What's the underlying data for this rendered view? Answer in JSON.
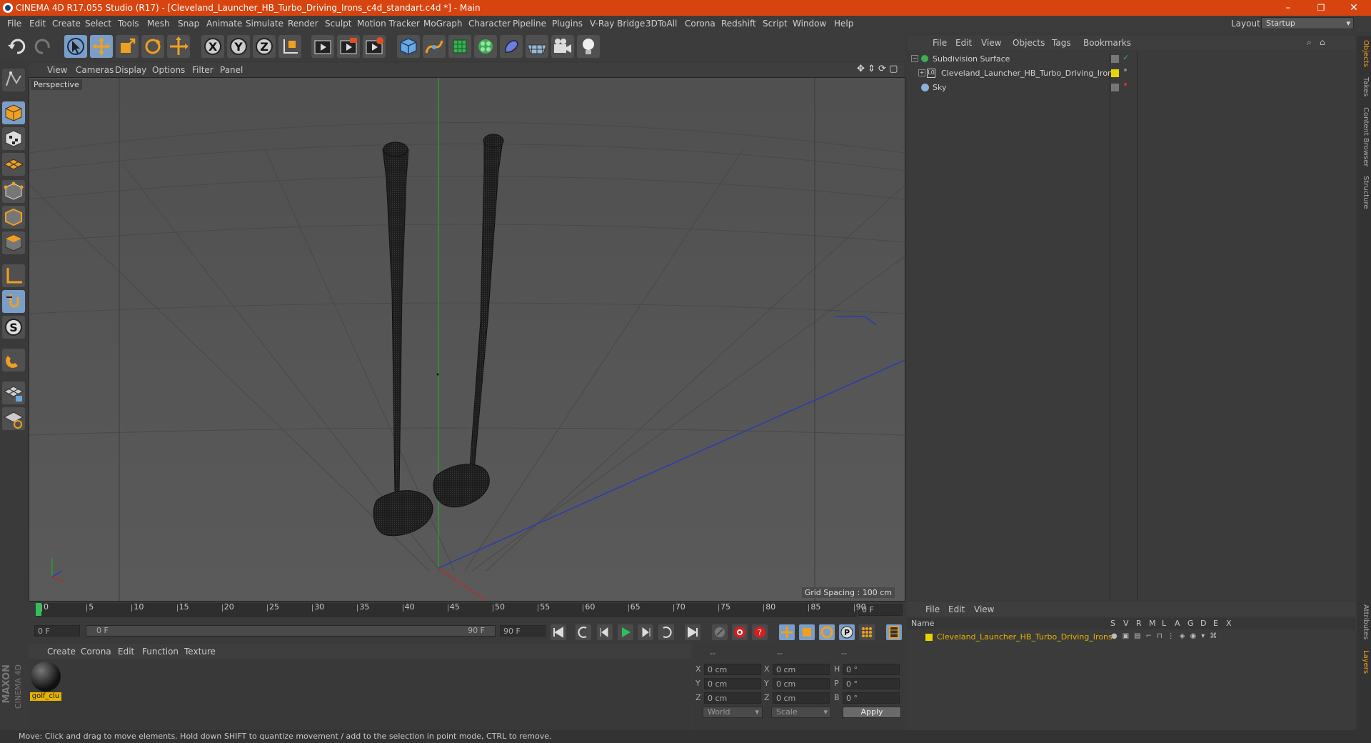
{
  "window": {
    "title": "CINEMA 4D R17.055 Studio (R17) - [Cleveland_Launcher_HB_Turbo_Driving_Irons_c4d_standart.c4d *] - Main",
    "minimize": "–",
    "restore": "❐",
    "close": "✕"
  },
  "menubar": {
    "items": [
      "File",
      "Edit",
      "Create",
      "Select",
      "Tools",
      "Mesh",
      "Snap",
      "Animate",
      "Simulate",
      "Render",
      "Sculpt",
      "Motion Tracker",
      "MoGraph",
      "Character",
      "Pipeline",
      "Plugins",
      "V-Ray Bridge",
      "3DToAll",
      "Corona",
      "Redshift",
      "Script",
      "Window",
      "Help"
    ],
    "layout_label": "Layout:",
    "layout_value": "Startup"
  },
  "viewport": {
    "menu": [
      "View",
      "Cameras",
      "Display",
      "Options",
      "Filter",
      "Panel"
    ],
    "camera": "Perspective",
    "grid_spacing": "Grid Spacing : 100 cm"
  },
  "timeline": {
    "ticks": [
      "0",
      "5",
      "10",
      "15",
      "20",
      "25",
      "30",
      "35",
      "40",
      "45",
      "50",
      "55",
      "60",
      "65",
      "70",
      "75",
      "80",
      "85",
      "90"
    ],
    "current_frame": "0 F",
    "start_field": "0 F",
    "range_start": "0 F",
    "range_end": "90 F",
    "end_field": "90 F"
  },
  "materials": {
    "menu": [
      "Create",
      "Corona",
      "Edit",
      "Function",
      "Texture"
    ],
    "items": [
      {
        "name": "golf_clu"
      }
    ]
  },
  "coords": {
    "headers": [
      "--",
      "--",
      "--"
    ],
    "rows": [
      {
        "a": "X",
        "av": "0 cm",
        "b": "X",
        "bv": "0 cm",
        "c": "H",
        "cv": "0 °"
      },
      {
        "a": "Y",
        "av": "0 cm",
        "b": "Y",
        "bv": "0 cm",
        "c": "P",
        "cv": "0 °"
      },
      {
        "a": "Z",
        "av": "0 cm",
        "b": "Z",
        "bv": "0 cm",
        "c": "B",
        "cv": "0 °"
      }
    ],
    "world": "World",
    "scale": "Scale",
    "apply": "Apply"
  },
  "objects": {
    "menu": [
      "File",
      "Edit",
      "View",
      "Objects",
      "Tags",
      "Bookmarks"
    ],
    "items": [
      {
        "name": "Subdivision Surface"
      },
      {
        "name": "Cleveland_Launcher_HB_Turbo_Driving_Irons"
      },
      {
        "name": "Sky"
      }
    ]
  },
  "layers": {
    "menu": [
      "File",
      "Edit",
      "View"
    ],
    "columns": [
      "Name",
      "S",
      "V",
      "R",
      "M",
      "L",
      "A",
      "G",
      "D",
      "E",
      "X"
    ],
    "items": [
      {
        "name": "Cleveland_Launcher_HB_Turbo_Driving_Irons"
      }
    ]
  },
  "right_tabs": [
    "Objects",
    "Takes",
    "Content Browser",
    "Structure",
    "Attributes",
    "Layers"
  ],
  "brand": {
    "maxon": "MAXON",
    "c4d": "CINEMA 4D"
  },
  "status": "Move: Click and drag to move elements. Hold down SHIFT to quantize movement / add to the selection in point mode, CTRL to remove.",
  "colors": {
    "title_bar": "#d8440f",
    "accent": "#7a9ec8",
    "layer_name": "#e8b400"
  }
}
